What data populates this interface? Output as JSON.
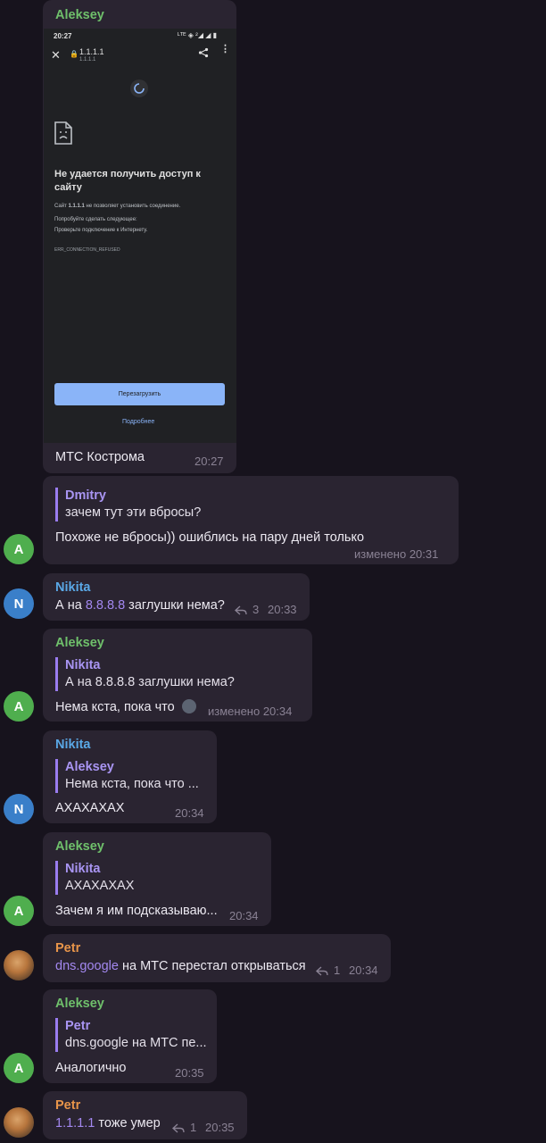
{
  "colors": {
    "background": "#17131d",
    "bubble": "#2a2431",
    "aleksey": "#6fc06b",
    "nikita": "#5aa8e6",
    "petr": "#e8954a",
    "dmitry": "#8f7cf0",
    "avatar_green": "#4fae4e",
    "avatar_blue": "#3a7fc9"
  },
  "messages": [
    {
      "sender": "Aleksey",
      "screenshot": {
        "status_time": "20:27",
        "status_icons": "ᴸᵀᴱ ◈ ²◢ ◢ ▮",
        "url": "1.1.1.1",
        "url_sub": "1.1.1.1",
        "error_title_line1": "Не удается получить доступ к",
        "error_title_line2": "сайту",
        "error_desc_prefix": "Сайт ",
        "error_desc_host": "1.1.1.1",
        "error_desc_suffix": " не позволяет установить соединение.",
        "try_label": "Попробуйте сделать следующее:",
        "try_item": "Проверьте подключение к Интернету.",
        "error_code": "ERR_CONNECTION_REFUSED",
        "reload_button": "Перезагрузить",
        "details_link": "Подробнее"
      },
      "text": "МТС Кострома",
      "time": "20:27"
    },
    {
      "sender": "",
      "avatar": "A",
      "quote_name": "Dmitry",
      "quote_text": "зачем тут эти вбросы?",
      "text": "Похоже не вбросы)) ошиблись на пару дней только",
      "time": "изменено 20:31"
    },
    {
      "sender": "Nikita",
      "avatar": "N",
      "text_prefix": "А на ",
      "text_link": "8.8.8.8",
      "text_suffix": " заглушки нема?",
      "replies": "3",
      "time": "20:33"
    },
    {
      "sender": "Aleksey",
      "avatar": "A",
      "quote_name": "Nikita",
      "quote_text": "А на 8.8.8.8 заглушки нема?",
      "text": "Нема кста, пока что",
      "time": "изменено 20:34"
    },
    {
      "sender": "Nikita",
      "avatar": "N",
      "quote_name": "Aleksey",
      "quote_text": "Нема кста, пока что ...",
      "text": "АХАХАХАХ",
      "time": "20:34"
    },
    {
      "sender": "Aleksey",
      "avatar": "A",
      "quote_name": "Nikita",
      "quote_text": "АХАХАХАХ",
      "text": "Зачем я им подсказываю...",
      "time": "20:34"
    },
    {
      "sender": "Petr",
      "text_link": "dns.google",
      "text_suffix": " на МТС перестал открываться",
      "replies": "1",
      "time": "20:34"
    },
    {
      "sender": "Aleksey",
      "avatar": "A",
      "quote_name": "Petr",
      "quote_text": "dns.google на МТС пе...",
      "text": "Аналогично",
      "time": "20:35"
    },
    {
      "sender": "Petr",
      "text_link": "1.1.1.1",
      "text_suffix": " тоже умер",
      "replies": "1",
      "time": "20:35"
    }
  ]
}
